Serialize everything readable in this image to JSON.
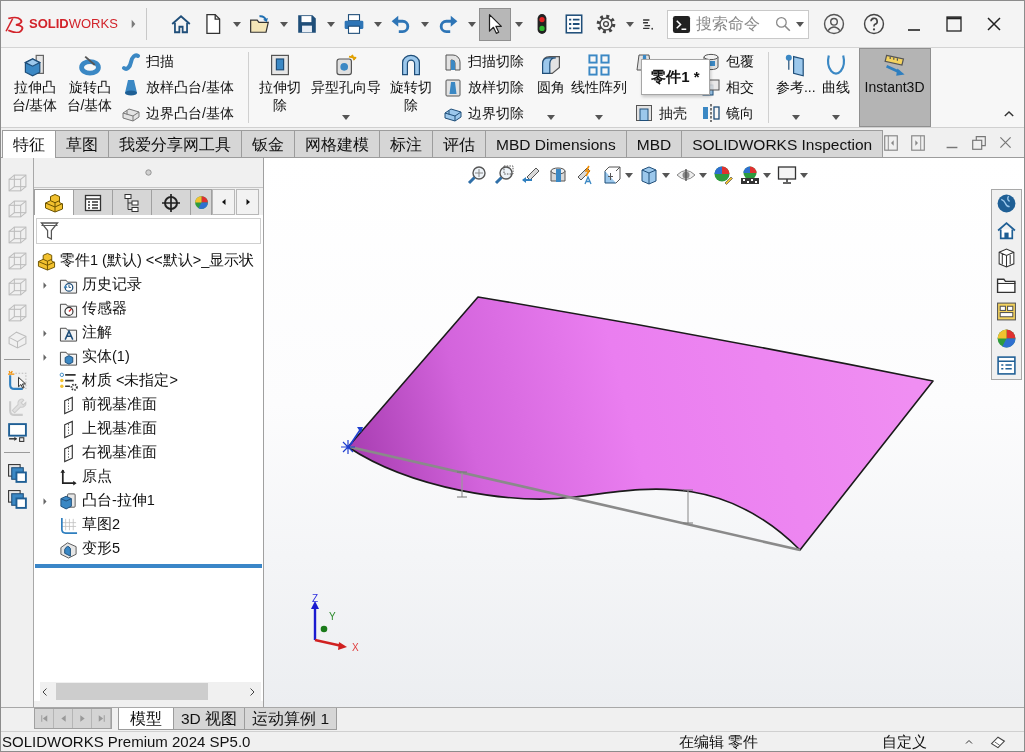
{
  "title_bar": {
    "logo": "**SOLID**WORKS",
    "quick_access": [
      {
        "kind": "home",
        "dropdown": false,
        "active": false
      },
      {
        "kind": "new",
        "dropdown": true,
        "active": false
      },
      {
        "kind": "open",
        "dropdown": true,
        "active": false
      },
      {
        "kind": "save",
        "dropdown": true,
        "active": false
      },
      {
        "kind": "print",
        "dropdown": true,
        "active": false
      },
      {
        "kind": "undo",
        "dropdown": true,
        "active": false
      },
      {
        "kind": "redo",
        "dropdown": true,
        "active": false
      },
      {
        "kind": "select",
        "dropdown": true,
        "active": true
      },
      {
        "kind": "rebuild",
        "dropdown": false,
        "active": false
      },
      {
        "kind": "file_properties",
        "dropdown": false,
        "active": false
      },
      {
        "kind": "options",
        "dropdown": true,
        "active": false
      },
      {
        "kind": "customize",
        "dropdown": false,
        "active": false
      }
    ],
    "search": {
      "placeholder": "搜索命令"
    }
  },
  "ribbon": {
    "groups": [
      {
        "items": [
          {
            "kind": "extrude_boss",
            "label": "拉伸凸台/基体",
            "dropdown": false,
            "active": false
          },
          {
            "kind": "revolve_boss",
            "label": "旋转凸台/基体",
            "dropdown": false,
            "active": false
          },
          {
            "rows": [
              {
                "kind": "sweep",
                "label": "扫描"
              },
              {
                "kind": "loft",
                "label": "放样凸台/基体"
              },
              {
                "kind": "boundary",
                "label": "边界凸台/基体"
              }
            ]
          }
        ]
      },
      {
        "items": [
          {
            "kind": "extrude_cut",
            "label": "拉伸切除",
            "dropdown": false,
            "active": false
          },
          {
            "kind": "hole_wizard",
            "label": "异型孔向导",
            "dropdown": true,
            "active": false
          },
          {
            "kind": "revolve_cut",
            "label": "旋转切除",
            "dropdown": false,
            "active": false
          },
          {
            "rows": [
              {
                "kind": "sweep_cut",
                "label": "扫描切除"
              },
              {
                "kind": "loft_cut",
                "label": "放样切除"
              },
              {
                "kind": "boundary_cut",
                "label": "边界切除"
              }
            ]
          },
          {
            "kind": "fillet",
            "label": "圆角",
            "dropdown": true,
            "active": false
          },
          {
            "kind": "linear_pattern",
            "label": "线性阵列",
            "dropdown": true,
            "active": false
          },
          {
            "rows": [
              {
                "kind": "draft"
              },
              {
                "kind": "shell",
                "label": "抽壳"
              }
            ]
          },
          {
            "rows": [
              {
                "kind": "wrap",
                "label": "包覆"
              },
              {
                "kind": "intersect",
                "label": "相交"
              },
              {
                "kind": "mirror",
                "label": "镜向"
              }
            ]
          }
        ]
      },
      {
        "items": [
          {
            "kind": "reference",
            "label": "参考...",
            "dropdown": true,
            "active": false
          },
          {
            "kind": "curve",
            "label": "曲线",
            "dropdown": true,
            "active": false
          },
          {
            "kind": "instant3d",
            "label": "Instant3D",
            "dropdown": false,
            "active": true
          }
        ]
      }
    ]
  },
  "tooltip": "零件1 *",
  "command_tabs": [
    {
      "label": "特征",
      "selected": true
    },
    {
      "label": "草图",
      "selected": false
    },
    {
      "label": "我爱分享网工具",
      "selected": false
    },
    {
      "label": "钣金",
      "selected": false
    },
    {
      "label": "网格建模",
      "selected": false
    },
    {
      "label": "标注",
      "selected": false
    },
    {
      "label": "评估",
      "selected": false
    },
    {
      "label": "MBD Dimensions",
      "selected": false
    },
    {
      "label": "MBD",
      "selected": false
    },
    {
      "label": "SOLIDWORKS Inspection",
      "selected": false
    }
  ],
  "left_toolbar": [
    [
      {
        "kind": "view_cube",
        "disabled": true
      },
      {
        "kind": "view_cube",
        "disabled": true
      },
      {
        "kind": "view_cube",
        "disabled": true
      },
      {
        "kind": "view_cube",
        "disabled": true
      },
      {
        "kind": "view_cube",
        "disabled": true
      },
      {
        "kind": "view_cube",
        "disabled": true
      },
      {
        "kind": "view_block",
        "disabled": true
      }
    ],
    [
      {
        "kind": "sketch_select",
        "disabled": false
      },
      {
        "kind": "wrench",
        "disabled": true
      },
      {
        "kind": "screen",
        "disabled": false
      }
    ],
    [
      {
        "kind": "windows",
        "disabled": false
      },
      {
        "kind": "windows",
        "disabled": false
      }
    ]
  ],
  "feature_manager": {
    "tabs": [
      {
        "kind": "part",
        "selected": true
      },
      {
        "kind": "property",
        "selected": false
      },
      {
        "kind": "configuration",
        "selected": false
      },
      {
        "kind": "dimxpert",
        "selected": false
      },
      {
        "kind": "display",
        "selected": false
      }
    ],
    "tree": [
      {
        "label": "零件1 (默认) <<默认>_显示状",
        "kind": "part",
        "expander": false,
        "children": [
          {
            "label": "历史记录",
            "kind": "history",
            "expander": true
          },
          {
            "label": "传感器",
            "kind": "sensor",
            "expander": false
          },
          {
            "label": "注解",
            "kind": "annotation",
            "expander": true
          },
          {
            "label": "实体(1)",
            "kind": "solid_bodies",
            "expander": true
          },
          {
            "label": "材质 <未指定>",
            "kind": "material",
            "expander": false
          },
          {
            "label": "前视基准面",
            "kind": "plane",
            "expander": false
          },
          {
            "label": "上视基准面",
            "kind": "plane",
            "expander": false
          },
          {
            "label": "右视基准面",
            "kind": "plane",
            "expander": false
          },
          {
            "label": "原点",
            "kind": "origin",
            "expander": false
          },
          {
            "label": "凸台-拉伸1",
            "kind": "extrude",
            "expander": true
          },
          {
            "label": "草图2",
            "kind": "sketch",
            "expander": false
          },
          {
            "label": "变形5",
            "kind": "deform",
            "expander": false
          }
        ]
      }
    ]
  },
  "view_toolbar": [
    {
      "kind": "zoom_fit",
      "dropdown": false
    },
    {
      "kind": "zoom_area",
      "dropdown": false
    },
    {
      "kind": "previous_view",
      "dropdown": false
    },
    {
      "kind": "section_view",
      "dropdown": false
    },
    {
      "kind": "dynamic_annotation",
      "dropdown": false
    },
    {
      "kind": "view_orientation",
      "dropdown": true
    },
    {
      "kind": "display_style",
      "dropdown": true
    },
    {
      "kind": "hide_show",
      "dropdown": true
    },
    {
      "kind": "edit_appearance",
      "dropdown": false
    },
    {
      "kind": "apply_scene",
      "dropdown": true
    },
    {
      "kind": "view_settings",
      "dropdown": true
    }
  ],
  "graphics": {
    "triad": {
      "z": "Z",
      "y": "Y",
      "x": "X"
    }
  },
  "bottom_tabs": [
    {
      "label": "模型",
      "selected": true
    },
    {
      "label": "3D 视图",
      "selected": false
    },
    {
      "label": "运动算例 1",
      "selected": false
    }
  ],
  "status_bar": {
    "product": "SOLIDWORKS Premium 2024 SP5.0",
    "mode": "在编辑 零件",
    "units": "自定义"
  }
}
